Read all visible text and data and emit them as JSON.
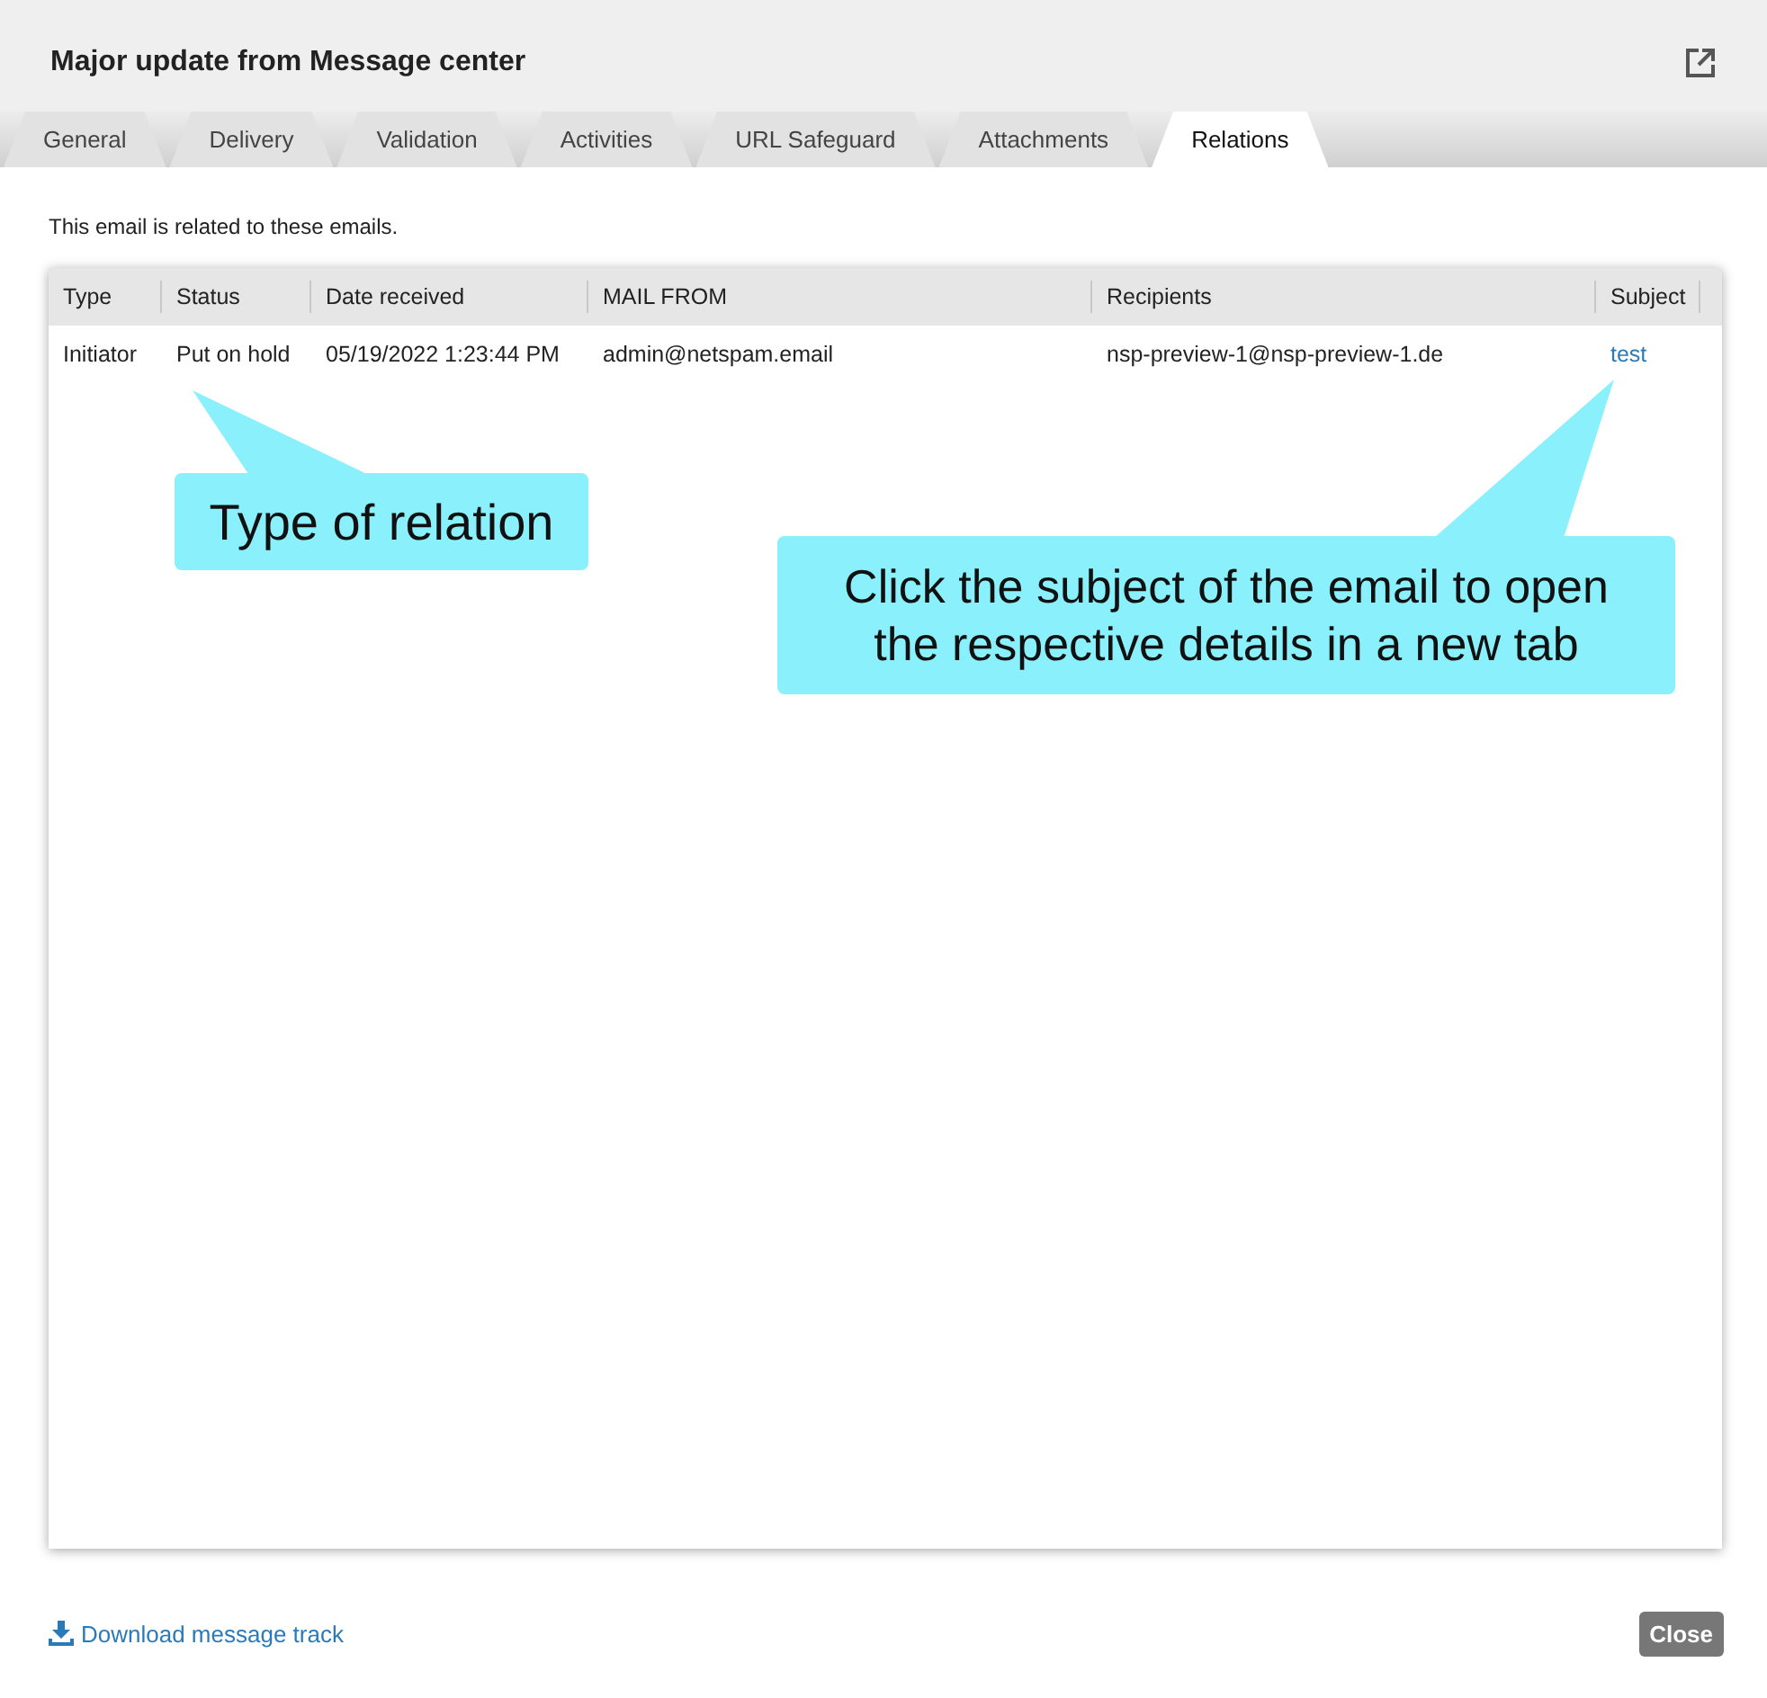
{
  "window": {
    "title": "Major update from Message center"
  },
  "tabs": [
    {
      "label": "General",
      "selected": false
    },
    {
      "label": "Delivery",
      "selected": false
    },
    {
      "label": "Validation",
      "selected": false
    },
    {
      "label": "Activities",
      "selected": false
    },
    {
      "label": "URL Safeguard",
      "selected": false
    },
    {
      "label": "Attachments",
      "selected": false
    },
    {
      "label": "Relations",
      "selected": true
    }
  ],
  "intro": "This email is related to these emails.",
  "table": {
    "columns": [
      "Type",
      "Status",
      "Date received",
      "MAIL FROM",
      "Recipients",
      "Subject"
    ],
    "rows": [
      {
        "cells": [
          "Initiator",
          "Put on hold",
          "05/19/2022 1:23:44 PM",
          "admin@netspam.email",
          "nsp-preview-1@nsp-preview-1.de",
          "test"
        ]
      }
    ]
  },
  "callouts": [
    {
      "text": "Type of relation"
    },
    {
      "text": "Click the subject of the email to open the respective details in a new tab"
    }
  ],
  "footer": {
    "download_link": "Download message track",
    "close_button": "Close"
  }
}
